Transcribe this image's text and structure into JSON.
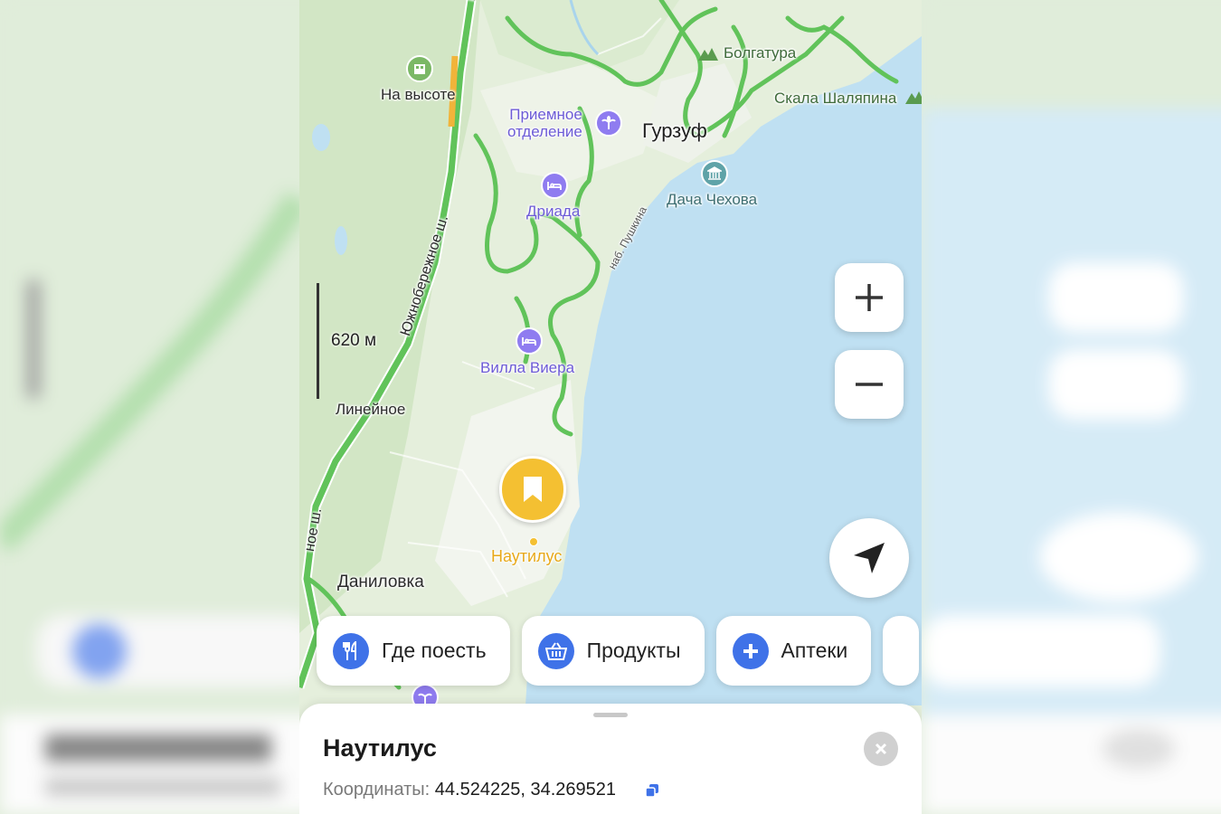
{
  "map": {
    "colors": {
      "land": "#e5efdc",
      "forest": "#d2e6c5",
      "sea": "#bfe0f2",
      "road": "#61c35a",
      "road_highlight": "#f1b43a",
      "poi": "#6d5bd7",
      "selected": "#f4c032"
    },
    "labels": {
      "road_south_top": "Юж",
      "road_south_main": "Южнобережное ш.",
      "road_south_bottom": "ное ш.",
      "na_vysote": "На высоте",
      "priemnoe": "Приемное\nотделение",
      "gurzuf": "Гурзуф",
      "bolgatura": "Болгатура",
      "skala": "Скала Шаляпина",
      "dacha": "Дача Чехова",
      "driada": "Дриада",
      "nab_pushkina": "наб. Пушкина",
      "villa": "Вилла Виера",
      "lineynoe": "Линейное",
      "danilovka": "Даниловка",
      "selected_place": "Наутилус"
    },
    "icons": {
      "hotel": "hotel-icon",
      "beach": "palm-icon",
      "museum": "museum-icon",
      "hill": "mountain-icon",
      "bookmark": "bookmark-icon"
    }
  },
  "scale": {
    "label": "620 м"
  },
  "controls": {
    "zoom_in": "zoom-in",
    "zoom_out": "zoom-out",
    "locate": "my-location"
  },
  "chips": [
    {
      "label": "Где поесть",
      "icon": "fork-knife-icon"
    },
    {
      "label": "Продукты",
      "icon": "basket-icon"
    },
    {
      "label": "Аптеки",
      "icon": "plus-icon"
    }
  ],
  "sheet": {
    "title": "Наутилус",
    "coords_label": "Координаты:",
    "coords_value": "44.524225, 34.269521"
  }
}
